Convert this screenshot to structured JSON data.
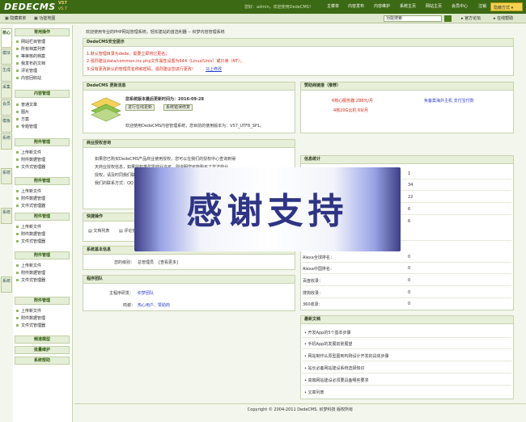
{
  "header": {
    "logo": "DEDECMS",
    "version_top": "V57",
    "version_bottom": "v5.7",
    "welcome": "您好：admin，欢迎使用DedeCMS！",
    "nav": [
      "主菜单",
      "内容发布",
      "内容维护",
      "系统主页",
      "网站主页",
      "会员中心",
      "注销"
    ],
    "style_button": "隐蔽方式 ▾"
  },
  "subbar": {
    "hide_menu": "隐藏菜单",
    "map": "功能地图",
    "search_value": "功能搜索",
    "forum": "官方论坛",
    "help": "在线帮助"
  },
  "rail": [
    "核心",
    "模块",
    "生成",
    "采集",
    "会员",
    "模板",
    "系统",
    "系统",
    "系统",
    "系统"
  ],
  "menu": {
    "sections": [
      {
        "title": "常用操作",
        "items": [
          "网站栏目管理",
          "所有档案列表",
          "等审核的档案",
          "我发布的文档",
          "评论管理",
          "内容回收站"
        ]
      },
      {
        "title": "内容管理",
        "items": [
          "普通文章",
          "图片",
          "方案",
          "专题管理"
        ]
      },
      {
        "title": "附件管理",
        "items": [
          "上传新文件",
          "附件数据管理",
          "文件式管理器"
        ]
      },
      {
        "title": "附件管理",
        "items": [
          "上传新文件",
          "附件数据管理",
          "文件式管理器"
        ]
      },
      {
        "title": "附件管理",
        "items": [
          "上传新文件",
          "附件数据管理",
          "文件式管理器"
        ]
      },
      {
        "title": "附件管理",
        "items": [
          "上传新文件",
          "附件数据管理",
          "文件式管理器"
        ]
      },
      {
        "title": "附件管理",
        "items": [
          "上传新文件",
          "附件数据管理",
          "文件式管理器"
        ]
      },
      {
        "title": "频道模型",
        "items": []
      },
      {
        "title": "批量维护",
        "items": []
      },
      {
        "title": "系统帮助",
        "items": []
      }
    ]
  },
  "main": {
    "intro": "欢迎使用专业的PHP网站管理系统，轻松建站的首选利器 -- 织梦内容管理系统",
    "security": {
      "title": "DedeCMS安全提示",
      "lines": [
        "1.默认管理目录为dede，需要立即将它更名；",
        "2.强烈建议data/common.inc.php文件属性设置为644（Linux/Unix）或只读（NT）；",
        "3.没有更改默认的管理员名称和密码，强烈建议您进行更改！"
      ],
      "link": "马上修改"
    },
    "update": {
      "title": "DedeCMS 更新消息",
      "status": "您系统版本最后更新时间为：2016-09-28",
      "btn_update": "进行在线更新",
      "btn_repair": "系统错误修复",
      "version_line": "欢迎使用DedeCMS内容管理系统，您目前的使用版本为：V57_UTF8_SP1。"
    },
    "sponsor": {
      "title": "赞助商链接（推荐）",
      "links": [
        "6核心服务器 288元/月",
        "免备案海外主机 支付宝付款",
        "4核20G云机 69/月"
      ]
    },
    "license": {
      "title": "商业授权咨询",
      "lines": [
        "如果您已购买DedeCMS产品商业使用授权，您可以在我们的授权中心查询到得",
        "天商业授权信息，如果授权类型需商业许可，则说明您可能购买了非法商业",
        "授权，请及时同我们联系。",
        "我们的联系方式：QQ"
      ]
    },
    "quick": {
      "title": "快捷操作",
      "items": [
        "文档列表",
        "评论管"
      ]
    },
    "sysinfo": {
      "title": "系统基本信息",
      "level_label": "您的级别：",
      "level_value": "总管理员",
      "level_more": "[查看更多]"
    },
    "team": {
      "title": "程序团队",
      "dev_label": "主程序研发：",
      "dev_value": "织梦团队",
      "thanks_label": "鸣谢：",
      "thanks_value": "热心用户、赞助商"
    },
    "stats": {
      "title": "信息统计",
      "values": [
        "1",
        "34",
        "22",
        "6",
        "6",
        "0",
        "0",
        "0",
        "0",
        "0"
      ],
      "labels": [
        "",
        "",
        "",
        "",
        "",
        "Alexa全球排名：",
        "Alexa中国排名：",
        "百度收录：",
        "搜狗收录：",
        "360收录："
      ]
    },
    "news": {
      "title": "最新文档",
      "items": [
        "开发App的5个基本步骤",
        "手机App的发展前景展望",
        "网站制作从原型图到构刚设计开发的具体步骤",
        "站长必备网站建设系统选择知识",
        "高端网站建设必须要具备哪些要求",
        "文章列表"
      ]
    }
  },
  "overlay": {
    "text": "感谢支持"
  },
  "footer": {
    "text": "Copyright © 2004-2011 DedeCMS. 织梦科技 版权所有"
  },
  "colors": {
    "header": "#3c6a14",
    "accent": "#d52a1a",
    "link": "#2b3fc9",
    "panel_title": "#e7efd8"
  }
}
